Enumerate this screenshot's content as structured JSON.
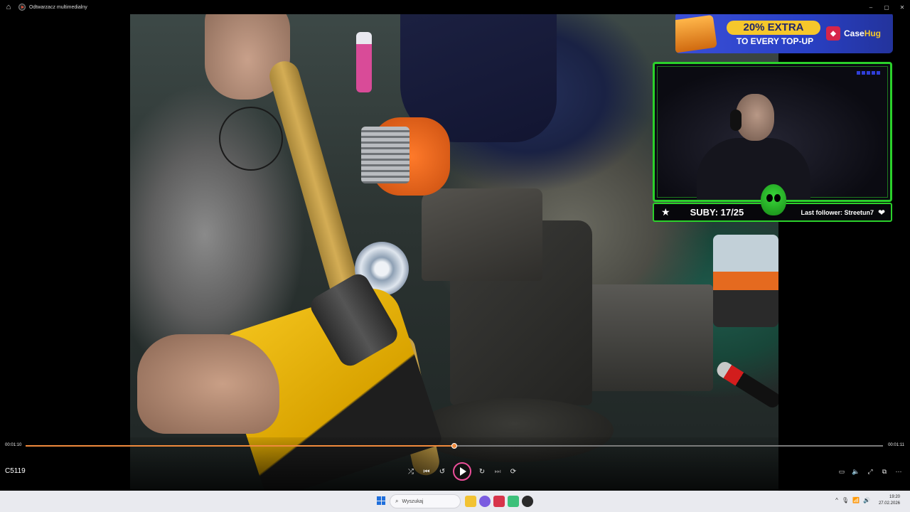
{
  "window": {
    "title": "Odtwarzacz multimedialny",
    "controls": [
      "–",
      "▢",
      "✕"
    ]
  },
  "overlay": {
    "ad": {
      "headline": "20% EXTRA",
      "subline": "TO EVERY TOP-UP",
      "brand_main": "Case",
      "brand_accent": "Hug"
    },
    "stats": {
      "star": "★",
      "subs": "SUBY: 17/25",
      "last_follower": "Last follower: Streetun7",
      "heart": "❤"
    }
  },
  "player": {
    "current_time": "00:01:10",
    "duration": "00:01:11",
    "progress_fraction": 0.5,
    "filename": "C5119",
    "accent_color": "#f08a3c",
    "buttons": {
      "shuffle": "⤮",
      "previous": "⏮",
      "rewind": "↺",
      "forward": "↻",
      "next": "⏭",
      "repeat": "⟳",
      "miniplayer": "▭",
      "volume": "🔈",
      "fullscreen": "⤢",
      "cast": "⧉",
      "more": "⋯"
    }
  },
  "taskbar": {
    "search_placeholder": "Wyszukaj",
    "clock_time": "19:20",
    "clock_date": "27.02.2026",
    "tray": {
      "chevron": "^",
      "mic": "🎙",
      "wifi": "📶",
      "speaker": "🔊"
    }
  }
}
